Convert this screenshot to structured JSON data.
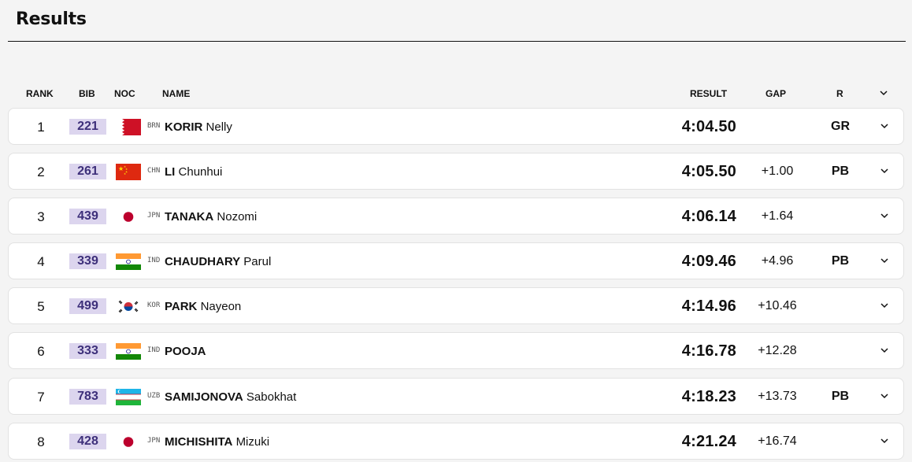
{
  "page": {
    "title": "Results"
  },
  "columns": {
    "rank": "RANK",
    "bib": "BIB",
    "noc": "NOC",
    "name": "NAME",
    "result": "RESULT",
    "gap": "GAP",
    "record": "R"
  },
  "rows": [
    {
      "rank": "1",
      "bib": "221",
      "noc": "BRN",
      "flag": "bahrain-flag",
      "last": "KORIR",
      "first": "Nelly",
      "result": "4:04.50",
      "gap": "",
      "record": "GR"
    },
    {
      "rank": "2",
      "bib": "261",
      "noc": "CHN",
      "flag": "china-flag",
      "last": "LI",
      "first": "Chunhui",
      "result": "4:05.50",
      "gap": "+1.00",
      "record": "PB"
    },
    {
      "rank": "3",
      "bib": "439",
      "noc": "JPN",
      "flag": "japan-flag",
      "last": "TANAKA",
      "first": "Nozomi",
      "result": "4:06.14",
      "gap": "+1.64",
      "record": ""
    },
    {
      "rank": "4",
      "bib": "339",
      "noc": "IND",
      "flag": "india-flag",
      "last": "CHAUDHARY",
      "first": "Parul",
      "result": "4:09.46",
      "gap": "+4.96",
      "record": "PB"
    },
    {
      "rank": "5",
      "bib": "499",
      "noc": "KOR",
      "flag": "korea-flag",
      "last": "PARK",
      "first": "Nayeon",
      "result": "4:14.96",
      "gap": "+10.46",
      "record": ""
    },
    {
      "rank": "6",
      "bib": "333",
      "noc": "IND",
      "flag": "india-flag",
      "last": "POOJA",
      "first": "",
      "result": "4:16.78",
      "gap": "+12.28",
      "record": ""
    },
    {
      "rank": "7",
      "bib": "783",
      "noc": "UZB",
      "flag": "uzbekistan-flag",
      "last": "SAMIJONOVA",
      "first": "Sabokhat",
      "result": "4:18.23",
      "gap": "+13.73",
      "record": "PB"
    },
    {
      "rank": "8",
      "bib": "428",
      "noc": "JPN",
      "flag": "japan-flag",
      "last": "MICHISHITA",
      "first": "Mizuki",
      "result": "4:21.24",
      "gap": "+16.74",
      "record": ""
    }
  ],
  "colors": {
    "bib_bg": "#dcd5ee",
    "bib_text": "#3d2f7a",
    "row_bg": "#ffffff",
    "page_bg": "#f4f4f4"
  }
}
